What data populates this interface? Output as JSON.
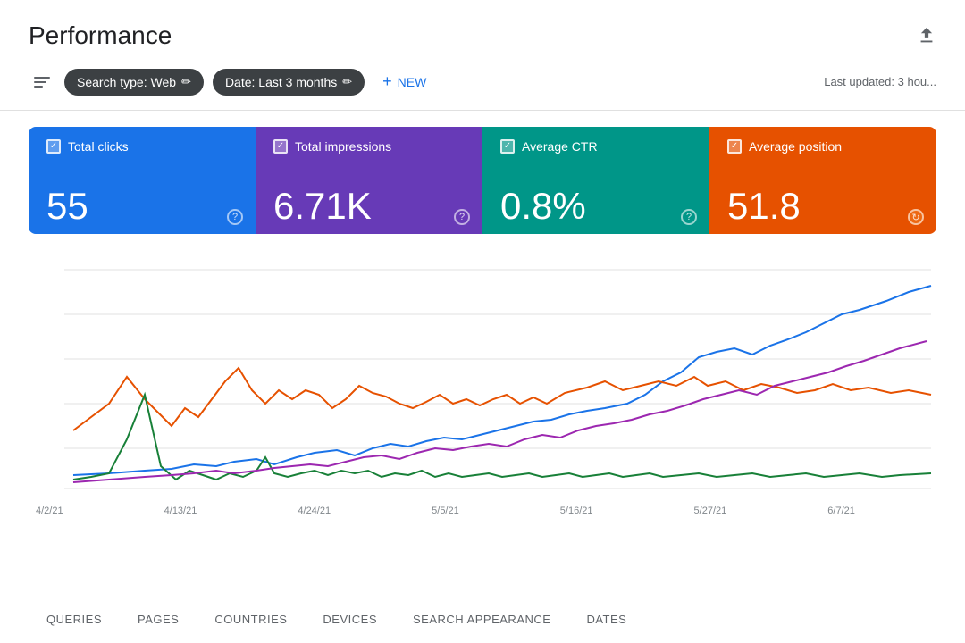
{
  "header": {
    "title": "Performance",
    "download_tooltip": "Download"
  },
  "toolbar": {
    "search_type_label": "Search type: Web",
    "date_label": "Date: Last 3 months",
    "new_label": "NEW",
    "last_updated": "Last updated: 3 hou..."
  },
  "metrics": [
    {
      "id": "clicks",
      "label": "Total clicks",
      "value": "55",
      "color": "#1a73e8"
    },
    {
      "id": "impressions",
      "label": "Total impressions",
      "value": "6.71K",
      "color": "#673ab7"
    },
    {
      "id": "ctr",
      "label": "Average CTR",
      "value": "0.8%",
      "color": "#009688"
    },
    {
      "id": "position",
      "label": "Average position",
      "value": "51.8",
      "color": "#e65100"
    }
  ],
  "chart": {
    "x_labels": [
      "4/2/21",
      "4/13/21",
      "4/24/21",
      "5/5/21",
      "5/16/21",
      "5/27/21",
      "6/7/21",
      ""
    ],
    "lines": {
      "clicks": {
        "color": "#1a73e8"
      },
      "impressions": {
        "color": "#e65100"
      },
      "ctr": {
        "color": "#188038"
      },
      "position": {
        "color": "#9c27b0"
      }
    }
  },
  "bottom_tabs": [
    {
      "id": "queries",
      "label": "QUERIES"
    },
    {
      "id": "pages",
      "label": "PAGES"
    },
    {
      "id": "countries",
      "label": "COUNTRIES"
    },
    {
      "id": "devices",
      "label": "DEVICES"
    },
    {
      "id": "search_appearance",
      "label": "SEARCH APPEARANCE"
    },
    {
      "id": "dates",
      "label": "DATES"
    }
  ]
}
